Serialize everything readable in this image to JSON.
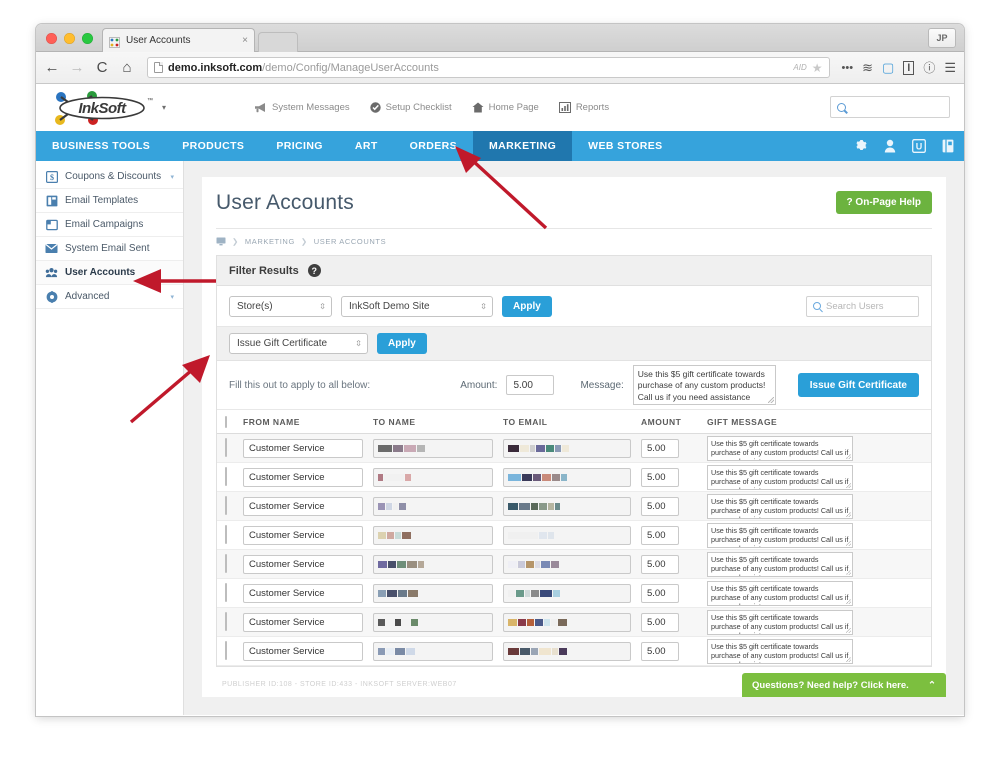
{
  "browser": {
    "tab_title": "User Accounts",
    "tab_close": "×",
    "back_icon": "←",
    "forward_icon": "→",
    "reload_icon": "C",
    "home_icon": "⌂",
    "url_host": "demo.inksoft.com",
    "url_path": "/demo/Config/ManageUserAccounts",
    "aid_label": "AID",
    "star_icon": "★",
    "ext_more": "•••",
    "ext_layers": "≋",
    "ext_frame": "▢",
    "ext_info": "ⓘ",
    "ext_bold": "I",
    "menu_icon": "☰",
    "profile_initials": "JP"
  },
  "header": {
    "logo_text": "InkSoft",
    "logo_caret": "▾",
    "util_links": [
      {
        "label": "System Messages",
        "icon": "megaphone-icon"
      },
      {
        "label": "Setup Checklist",
        "icon": "check-circle-icon"
      },
      {
        "label": "Home Page",
        "icon": "home-icon"
      },
      {
        "label": "Reports",
        "icon": "bar-chart-icon"
      }
    ],
    "search_placeholder": ""
  },
  "mainnav": {
    "items": [
      {
        "label": "BUSINESS TOOLS",
        "active": false
      },
      {
        "label": "PRODUCTS",
        "active": false
      },
      {
        "label": "PRICING",
        "active": false
      },
      {
        "label": "ART",
        "active": false
      },
      {
        "label": "ORDERS",
        "active": false
      },
      {
        "label": "MARKETING",
        "active": true
      },
      {
        "label": "WEB STORES",
        "active": false
      }
    ],
    "icons": [
      "gear-icon",
      "user-icon",
      "u-box-icon",
      "notebook-icon"
    ],
    "active_color": "#2077ae",
    "bar_color": "#36a3dc"
  },
  "sidebar": {
    "items": [
      {
        "label": "Coupons & Discounts",
        "icon": "dollar-box-icon",
        "caret": "▾",
        "active": false
      },
      {
        "label": "Email Templates",
        "icon": "template-icon",
        "caret": "",
        "active": false
      },
      {
        "label": "Email Campaigns",
        "icon": "campaign-icon",
        "caret": "",
        "active": false
      },
      {
        "label": "System Email Sent",
        "icon": "envelope-icon",
        "caret": "",
        "active": false
      },
      {
        "label": "User Accounts",
        "icon": "users-icon",
        "caret": "",
        "active": true
      },
      {
        "label": "Advanced",
        "icon": "gear-circle-icon",
        "caret": "▾",
        "active": false
      }
    ]
  },
  "page": {
    "title": "User Accounts",
    "help_button": "? On-Page Help",
    "help_color": "#6cb33f",
    "breadcrumb_home_icon": "monitor-icon",
    "breadcrumbs": [
      "MARKETING",
      "USER ACCOUNTS"
    ],
    "breadcrumb_sep": "❯"
  },
  "filter_panel": {
    "title": "Filter Results",
    "help_glyph": "?",
    "store_select": "Store(s)",
    "site_select": "InkSoft Demo Site",
    "apply_label": "Apply",
    "search_placeholder": "Search Users"
  },
  "action_panel": {
    "action_select": "Issue Gift Certificate",
    "apply_label": "Apply"
  },
  "bulk_row": {
    "instruction": "Fill this out to apply to all below:",
    "amount_label": "Amount:",
    "amount_value": "5.00",
    "message_label": "Message:",
    "message_value": "Use this $5 gift certificate towards purchase of any custom products! Call us if you need assistance",
    "issue_button": "Issue Gift Certificate"
  },
  "table": {
    "columns": [
      "FROM NAME",
      "TO NAME",
      "TO EMAIL",
      "AMOUNT",
      "GIFT MESSAGE"
    ],
    "rows": [
      {
        "from_name": "Customer Service",
        "to_name": "[redacted]",
        "to_email": "[redacted]",
        "amount": "5.00",
        "gift_message": "Use this $5 gift certificate towards purchase of any custom products! Call us if you need assistance"
      },
      {
        "from_name": "Customer Service",
        "to_name": "[redacted]",
        "to_email": "[redacted]",
        "amount": "5.00",
        "gift_message": "Use this $5 gift certificate towards purchase of any custom products! Call us if you need assistance"
      },
      {
        "from_name": "Customer Service",
        "to_name": "[redacted]",
        "to_email": "[redacted]",
        "amount": "5.00",
        "gift_message": "Use this $5 gift certificate towards purchase of any custom products! Call us if you need assistance"
      },
      {
        "from_name": "Customer Service",
        "to_name": "[redacted]",
        "to_email": "[redacted]",
        "amount": "5.00",
        "gift_message": "Use this $5 gift certificate towards purchase of any custom products! Call us if you need assistance"
      },
      {
        "from_name": "Customer Service",
        "to_name": "[redacted]",
        "to_email": "[redacted]",
        "amount": "5.00",
        "gift_message": "Use this $5 gift certificate towards purchase of any custom products! Call us if you need assistance"
      },
      {
        "from_name": "Customer Service",
        "to_name": "[redacted]",
        "to_email": "[redacted]",
        "amount": "5.00",
        "gift_message": "Use this $5 gift certificate towards purchase of any custom products! Call us if you need assistance"
      },
      {
        "from_name": "Customer Service",
        "to_name": "[redacted]",
        "to_email": "[redacted]",
        "amount": "5.00",
        "gift_message": "Use this $5 gift certificate towards purchase of any custom products! Call us if you need assistance"
      },
      {
        "from_name": "Customer Service",
        "to_name": "[redacted]",
        "to_email": "[redacted]",
        "amount": "5.00",
        "gift_message": "Use this $5 gift certificate towards purchase of any custom products! Call us if you need assistance"
      }
    ]
  },
  "footer": {
    "note": "PUBLISHER ID:108 - STORE ID:433 - INKSOFT SERVER:WEB07"
  },
  "chat": {
    "label": "Questions? Need help? Click here.",
    "chevron": "⌃",
    "color": "#7cbf3f"
  },
  "annotations": {
    "color": "#c0192b",
    "arrows": [
      {
        "name": "arrow-to-marketing-tab",
        "desc": "points up to MARKETING nav tab"
      },
      {
        "name": "arrow-to-user-accounts",
        "desc": "points left to User Accounts sidebar item"
      },
      {
        "name": "arrow-to-issue-gift-certificate-select",
        "desc": "points up-right to Issue Gift Certificate dropdown"
      }
    ]
  }
}
